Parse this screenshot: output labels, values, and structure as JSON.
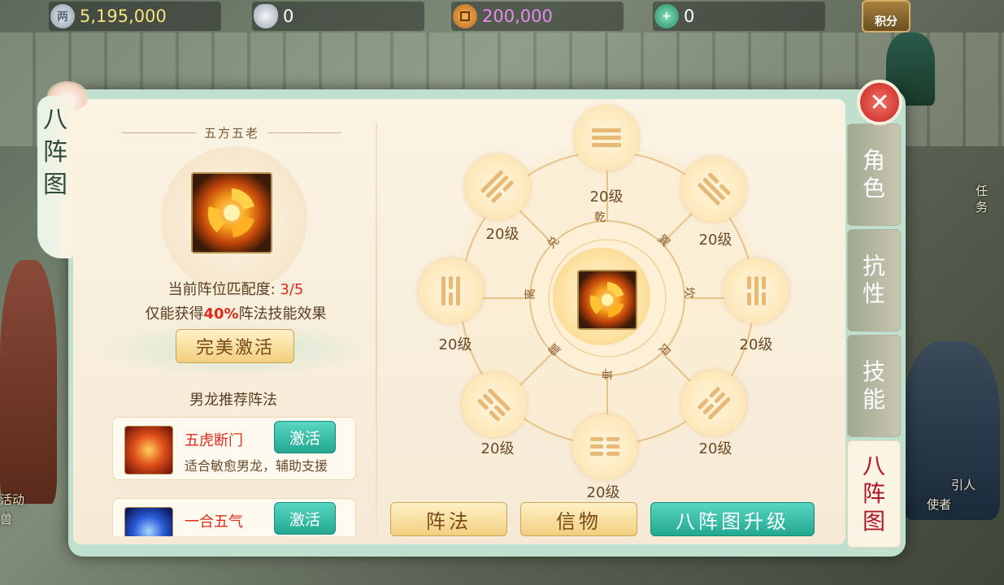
{
  "resources": [
    {
      "icon": "silver-coin-icon",
      "value": "5,195,000",
      "color": "#f4e37c"
    },
    {
      "icon": "silver-ingot-icon",
      "value": "0",
      "color": "#ffffff"
    },
    {
      "icon": "copper-coin-icon",
      "value": "200,000",
      "color": "#e58be8"
    },
    {
      "icon": "jade-add-icon",
      "value": "0",
      "color": "#ffffff"
    }
  ],
  "score_button": "积分",
  "background_labels": [
    "活动",
    "兽",
    "引人",
    "使者",
    "任务"
  ],
  "panel": {
    "title_chars": [
      "八",
      "阵",
      "图"
    ],
    "formation_name": "五方五老",
    "match_label": "当前阵位匹配度: ",
    "match_value": "3/5",
    "effect_prefix": "仅能获得",
    "effect_percent": "40%",
    "effect_suffix": "阵法技能效果",
    "perfect_button": "完美激活",
    "recommend_title": "男龙推荐阵法",
    "recommendations": [
      {
        "name": "五虎断门",
        "desc": "适合敏愈男龙，辅助支援",
        "button": "激活"
      },
      {
        "name": "一合五气",
        "desc": "",
        "button": "激活"
      }
    ]
  },
  "bagua": {
    "nodes": [
      {
        "pos": "top",
        "level": "20级"
      },
      {
        "pos": "top-right",
        "level": "20级"
      },
      {
        "pos": "right",
        "level": "20级"
      },
      {
        "pos": "bottom-right",
        "level": "20级"
      },
      {
        "pos": "bottom",
        "level": "20级"
      },
      {
        "pos": "bottom-left",
        "level": "20级"
      },
      {
        "pos": "left",
        "level": "20级"
      },
      {
        "pos": "top-left",
        "level": "20级"
      }
    ],
    "gua_names": [
      "乾",
      "巽",
      "坎",
      "艮",
      "坤",
      "震",
      "离",
      "兑"
    ]
  },
  "bottom_buttons": [
    "阵法",
    "信物",
    "八阵图升级"
  ],
  "side_tabs": [
    {
      "label": "角色",
      "active": false
    },
    {
      "label": "抗性",
      "active": false
    },
    {
      "label": "技能",
      "active": false
    },
    {
      "label": "八阵图",
      "active": true
    }
  ]
}
